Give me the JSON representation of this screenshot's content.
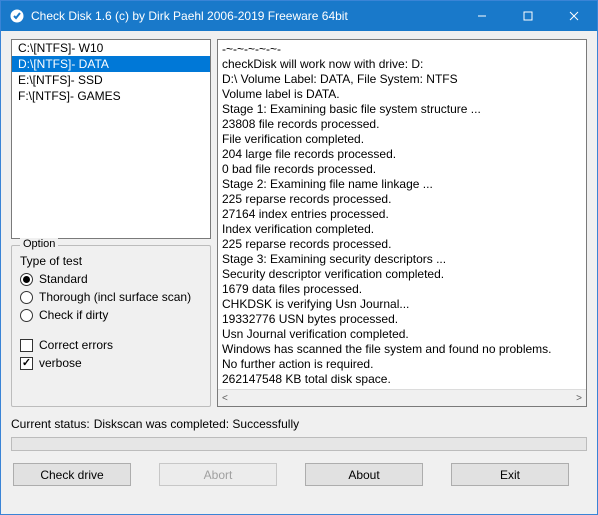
{
  "titlebar": {
    "title": "Check Disk 1.6 (c) by Dirk Paehl  2006-2019 Freeware 64bit"
  },
  "drives": [
    {
      "label": "C:\\[NTFS]- W10",
      "selected": false
    },
    {
      "label": "D:\\[NTFS]- DATA",
      "selected": true
    },
    {
      "label": "E:\\[NTFS]- SSD",
      "selected": false
    },
    {
      "label": "F:\\[NTFS]- GAMES",
      "selected": false
    }
  ],
  "options": {
    "legend": "Option",
    "type_label": "Type of test",
    "radios": {
      "standard": "Standard",
      "thorough": "Thorough (incl surface scan)",
      "dirty": "Check if dirty"
    },
    "selected_radio": "standard",
    "checks": {
      "correct": "Correct errors",
      "verbose": "verbose"
    },
    "correct_checked": false,
    "verbose_checked": true
  },
  "output": [
    "-~-~-~-~-~-",
    "checkDisk will work now with drive: D:",
    "D:\\ Volume Label: DATA, File System: NTFS",
    "Volume label is DATA.",
    "Stage 1: Examining basic file system structure ...",
    "23808 file records processed.",
    "File verification completed.",
    "204 large file records processed.",
    "0 bad file records processed.",
    "Stage 2: Examining file name linkage ...",
    "225 reparse records processed.",
    "27164 index entries processed.",
    "Index verification completed.",
    "225 reparse records processed.",
    "Stage 3: Examining security descriptors ...",
    "Security descriptor verification completed.",
    "1679 data files processed.",
    "CHKDSK is verifying Usn Journal...",
    "19332776 USN bytes processed.",
    "Usn Journal verification completed.",
    "Windows has scanned the file system and found no problems.",
    "No further action is required.",
    "262147548 KB total disk space."
  ],
  "status": {
    "label": "Current status:",
    "value": "Diskscan was completed: Successfully"
  },
  "buttons": {
    "check": "Check drive",
    "abort": "Abort",
    "about": "About",
    "exit": "Exit"
  }
}
